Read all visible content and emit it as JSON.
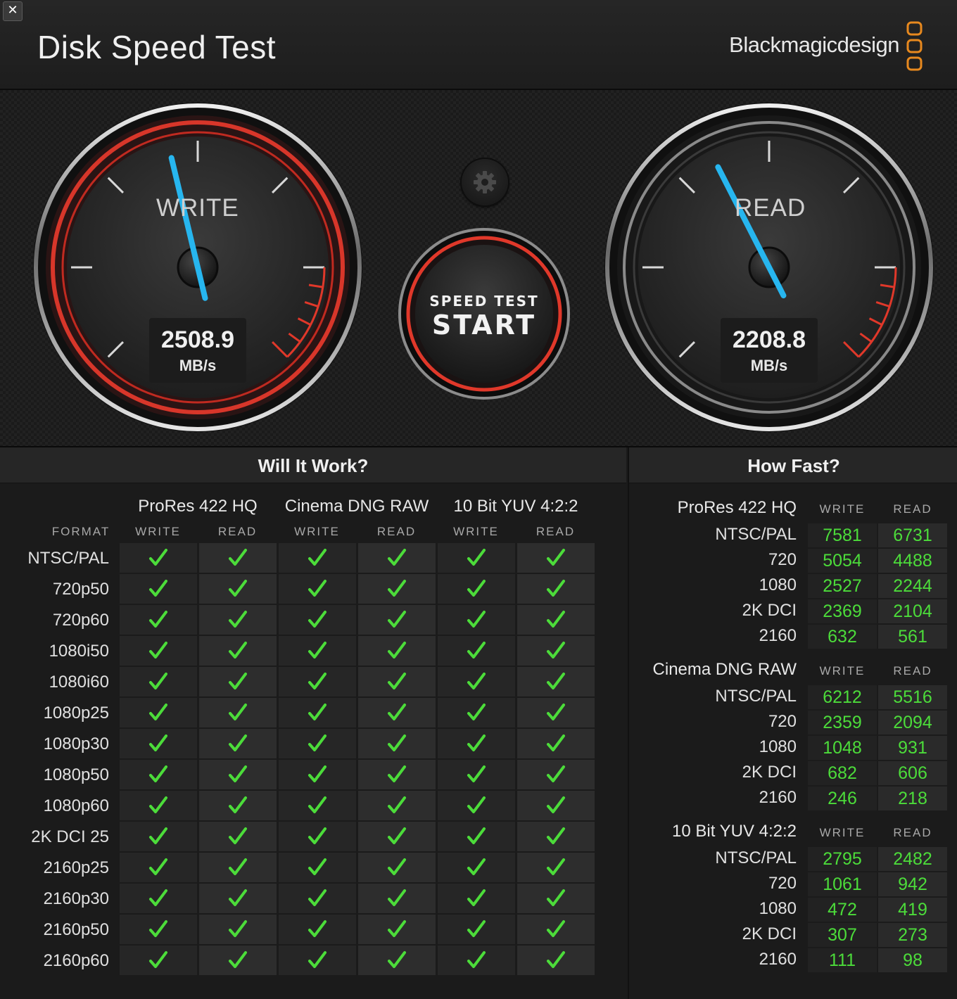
{
  "app": {
    "title": "Disk Speed Test",
    "brand": "Blackmagicdesign",
    "close_label": "✕"
  },
  "gauges": {
    "write": {
      "label": "WRITE",
      "value": "2508.9",
      "unit": "MB/s",
      "needle_fraction": 0.45
    },
    "read": {
      "label": "READ",
      "value": "2208.8",
      "unit": "MB/s",
      "needle_fraction": 0.4
    }
  },
  "start_button": {
    "line1": "SPEED TEST",
    "line2": "START"
  },
  "settings": {
    "icon": "gear-icon"
  },
  "colors": {
    "accent_red": "#e0382a",
    "needle_blue": "#27b6ef",
    "value_green": "#4cdc3a",
    "check_green": "#4cdc3a"
  },
  "will_it_work": {
    "title": "Will It Work?",
    "format_header": "FORMAT",
    "codecs": [
      "ProRes 422 HQ",
      "Cinema DNG RAW",
      "10 Bit YUV 4:2:2"
    ],
    "write_label": "WRITE",
    "read_label": "READ",
    "formats": [
      "NTSC/PAL",
      "720p50",
      "720p60",
      "1080i50",
      "1080i60",
      "1080p25",
      "1080p30",
      "1080p50",
      "1080p60",
      "2K DCI 25",
      "2160p25",
      "2160p30",
      "2160p50",
      "2160p60"
    ],
    "results": [
      [
        true,
        true,
        true,
        true,
        true,
        true
      ],
      [
        true,
        true,
        true,
        true,
        true,
        true
      ],
      [
        true,
        true,
        true,
        true,
        true,
        true
      ],
      [
        true,
        true,
        true,
        true,
        true,
        true
      ],
      [
        true,
        true,
        true,
        true,
        true,
        true
      ],
      [
        true,
        true,
        true,
        true,
        true,
        true
      ],
      [
        true,
        true,
        true,
        true,
        true,
        true
      ],
      [
        true,
        true,
        true,
        true,
        true,
        true
      ],
      [
        true,
        true,
        true,
        true,
        true,
        true
      ],
      [
        true,
        true,
        true,
        true,
        true,
        true
      ],
      [
        true,
        true,
        true,
        true,
        true,
        true
      ],
      [
        true,
        true,
        true,
        true,
        true,
        true
      ],
      [
        true,
        true,
        true,
        true,
        true,
        true
      ],
      [
        true,
        true,
        true,
        true,
        true,
        true
      ]
    ]
  },
  "how_fast": {
    "title": "How Fast?",
    "write_label": "WRITE",
    "read_label": "READ",
    "groups": [
      {
        "name": "ProRes 422 HQ",
        "rows": [
          {
            "label": "NTSC/PAL",
            "write": "7581",
            "read": "6731"
          },
          {
            "label": "720",
            "write": "5054",
            "read": "4488"
          },
          {
            "label": "1080",
            "write": "2527",
            "read": "2244"
          },
          {
            "label": "2K DCI",
            "write": "2369",
            "read": "2104"
          },
          {
            "label": "2160",
            "write": "632",
            "read": "561"
          }
        ]
      },
      {
        "name": "Cinema DNG RAW",
        "rows": [
          {
            "label": "NTSC/PAL",
            "write": "6212",
            "read": "5516"
          },
          {
            "label": "720",
            "write": "2359",
            "read": "2094"
          },
          {
            "label": "1080",
            "write": "1048",
            "read": "931"
          },
          {
            "label": "2K DCI",
            "write": "682",
            "read": "606"
          },
          {
            "label": "2160",
            "write": "246",
            "read": "218"
          }
        ]
      },
      {
        "name": "10 Bit YUV 4:2:2",
        "rows": [
          {
            "label": "NTSC/PAL",
            "write": "2795",
            "read": "2482"
          },
          {
            "label": "720",
            "write": "1061",
            "read": "942"
          },
          {
            "label": "1080",
            "write": "472",
            "read": "419"
          },
          {
            "label": "2K DCI",
            "write": "307",
            "read": "273"
          },
          {
            "label": "2160",
            "write": "111",
            "read": "98"
          }
        ]
      }
    ]
  }
}
